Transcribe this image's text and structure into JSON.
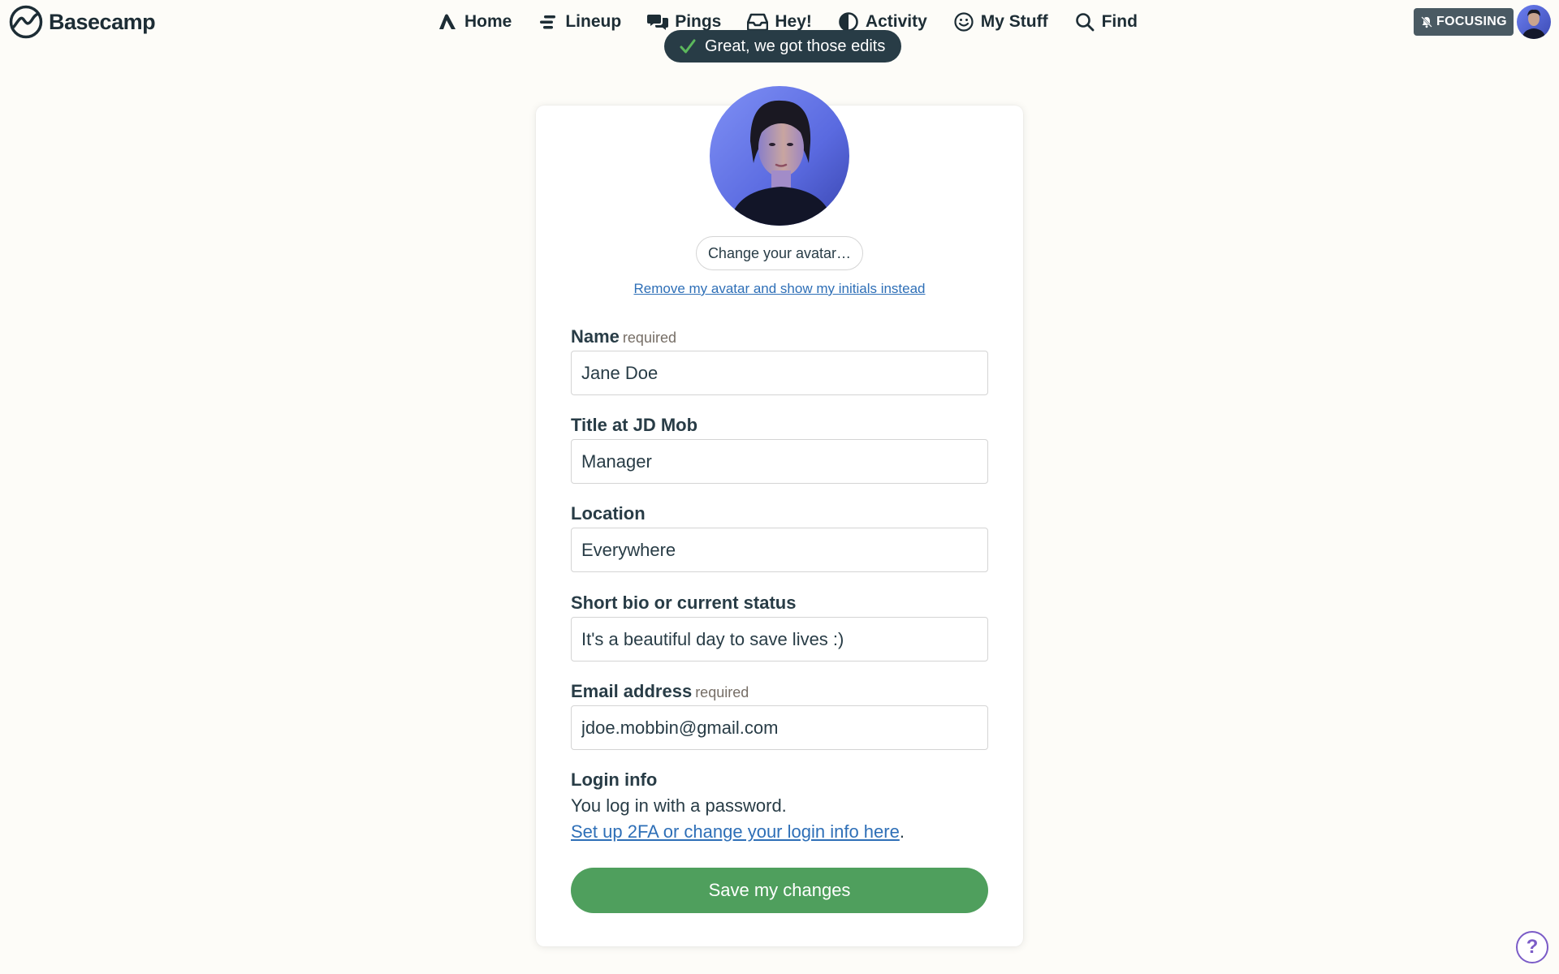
{
  "app": {
    "name": "Basecamp"
  },
  "nav": {
    "items": [
      {
        "label": "Home",
        "icon": "home-icon"
      },
      {
        "label": "Lineup",
        "icon": "lineup-icon"
      },
      {
        "label": "Pings",
        "icon": "pings-icon"
      },
      {
        "label": "Hey!",
        "icon": "hey-inbox-icon"
      },
      {
        "label": "Activity",
        "icon": "activity-icon"
      },
      {
        "label": "My Stuff",
        "icon": "my-stuff-icon"
      },
      {
        "label": "Find",
        "icon": "search-icon"
      }
    ],
    "focusing_label": "FOCUSING",
    "focusing_icon": "bell-off-icon"
  },
  "flash": {
    "message": "Great, we got those edits",
    "icon": "checkmark-icon"
  },
  "profile": {
    "change_avatar_label": "Change your avatar…",
    "remove_avatar_label": "Remove my avatar and show my initials instead",
    "fields": {
      "name": {
        "label": "Name",
        "required": "required",
        "value": "Jane Doe"
      },
      "title": {
        "label": "Title at JD Mob",
        "value": "Manager"
      },
      "location": {
        "label": "Location",
        "value": "Everywhere"
      },
      "bio": {
        "label": "Short bio or current status",
        "value": "It's a beautiful day to save lives :)"
      },
      "email": {
        "label": "Email address",
        "required": "required",
        "value": "jdoe.mobbin@gmail.com"
      }
    },
    "login": {
      "title": "Login info",
      "text": "You log in with a password.",
      "link_label": "Set up 2FA or change your login info here",
      "trailing": "."
    },
    "save_label": "Save my changes"
  },
  "help": {
    "label": "?"
  },
  "colors": {
    "background": "#fdfcf8",
    "text": "#283c46",
    "link": "#2e6fb7",
    "save_button": "#4f9f5d",
    "flash_background": "#283c46",
    "flash_check": "#5cb85c",
    "help_accent": "#7b5cc7"
  }
}
